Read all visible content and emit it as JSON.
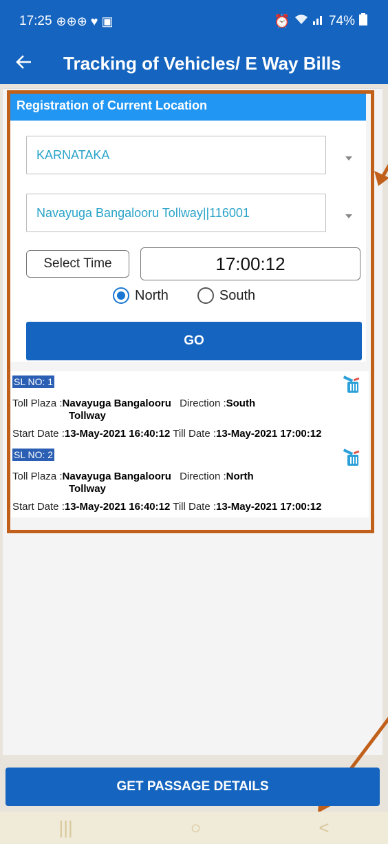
{
  "status_bar": {
    "time": "17:25",
    "notif_icons": [
      "⊕⊕⊕",
      "♥",
      "▣"
    ],
    "battery": "74%"
  },
  "app_bar": {
    "back_icon": "arrow-left-icon",
    "title": "Tracking of Vehicles/ E Way Bills"
  },
  "registration": {
    "header": "Registration of Current Location",
    "state_value": "KARNATAKA",
    "toll_value": "Navayuga Bangalooru Tollway||116001",
    "select_time_label": "Select Time",
    "time_value": "17:00:12",
    "direction_options": [
      "North",
      "South"
    ],
    "selected_direction": "North",
    "go_label": "GO"
  },
  "records": [
    {
      "sl": "SL NO: 1",
      "toll_label": "Toll Plaza :",
      "toll_name_1": "Navayuga Bangalooru",
      "toll_name_2": "Tollway",
      "direction_label": "Direction :",
      "direction": "South",
      "start_label": "Start Date :",
      "start_date": "13-May-2021 16:40:12",
      "till_label": "Till Date :",
      "till_date": "13-May-2021 17:00:12"
    },
    {
      "sl": "SL NO: 2",
      "toll_label": "Toll Plaza :",
      "toll_name_1": "Navayuga Bangalooru",
      "toll_name_2": "Tollway",
      "direction_label": "Direction :",
      "direction": "North",
      "start_label": "Start Date :",
      "start_date": "13-May-2021 16:40:12",
      "till_label": "Till Date :",
      "till_date": "13-May-2021 17:00:12"
    }
  ],
  "passage_button": "GET PASSAGE DETAILS",
  "nav": {
    "recents": "|||",
    "home": "○",
    "back": "<"
  },
  "colors": {
    "primary": "#1565c0",
    "header_blue": "#2196f3",
    "annotation": "#c0601a"
  }
}
